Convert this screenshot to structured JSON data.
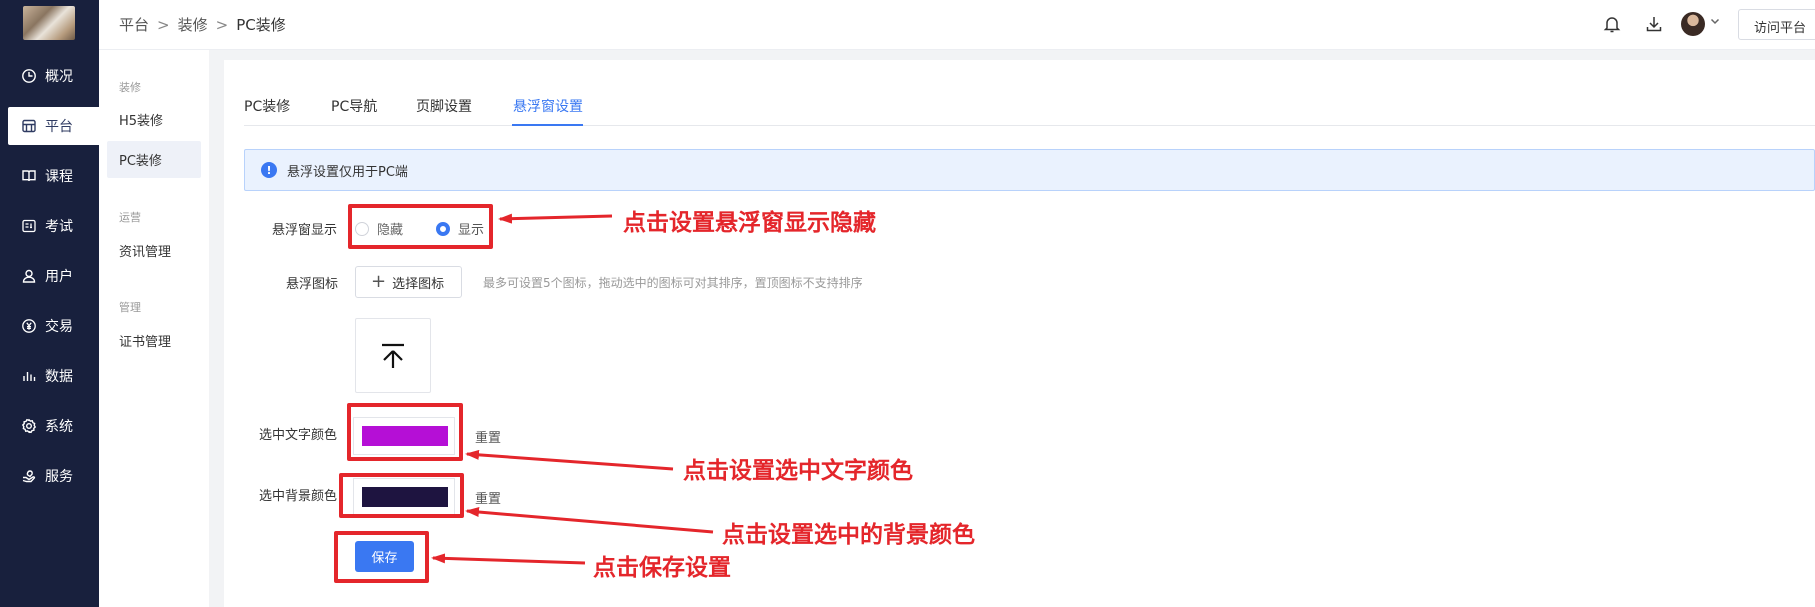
{
  "nav": {
    "items": [
      {
        "label": "概况",
        "icon": "dashboard-icon"
      },
      {
        "label": "平台",
        "icon": "store-icon"
      },
      {
        "label": "课程",
        "icon": "book-icon"
      },
      {
        "label": "考试",
        "icon": "exam-icon"
      },
      {
        "label": "用户",
        "icon": "user-icon"
      },
      {
        "label": "交易",
        "icon": "yen-icon"
      },
      {
        "label": "数据",
        "icon": "bar-chart-icon"
      },
      {
        "label": "系统",
        "icon": "gear-icon"
      },
      {
        "label": "服务",
        "icon": "service-icon"
      }
    ],
    "active": "平台"
  },
  "subnav": {
    "groups": [
      {
        "title": "装修",
        "items": [
          "H5装修",
          "PC装修"
        ]
      },
      {
        "title": "运营",
        "items": [
          "资讯管理"
        ]
      },
      {
        "title": "管理",
        "items": [
          "证书管理"
        ]
      }
    ],
    "active": "PC装修"
  },
  "header": {
    "breadcrumb": [
      "平台",
      "装修",
      "PC装修"
    ],
    "breadcrumb_sep": ">",
    "visit_button": "访问平台"
  },
  "tabs": {
    "items": [
      "PC装修",
      "PC导航",
      "页脚设置",
      "悬浮窗设置"
    ],
    "active": "悬浮窗设置"
  },
  "notice": {
    "text": "悬浮设置仅用于PC端",
    "icon": "info-icon"
  },
  "form": {
    "display_label": "悬浮窗显示",
    "radio_hide": "隐藏",
    "radio_show": "显示",
    "display_value": "显示",
    "icon_label": "悬浮图标",
    "choose_icon_button": "选择图标",
    "icon_hint": "最多可设置5个图标，拖动选中的图标可对其排序，置顶图标不支持排序",
    "text_color_label": "选中文字颜色",
    "text_color": "#b50fd6",
    "bg_color_label": "选中背景颜色",
    "bg_color": "#1e1440",
    "reset_label": "重置",
    "save_button": "保存"
  },
  "annotations": {
    "color": "#e4262b",
    "items": [
      "点击设置悬浮窗显示隐藏",
      "点击设置选中文字颜色",
      "点击设置选中的背景颜色",
      "点击保存设置"
    ]
  }
}
